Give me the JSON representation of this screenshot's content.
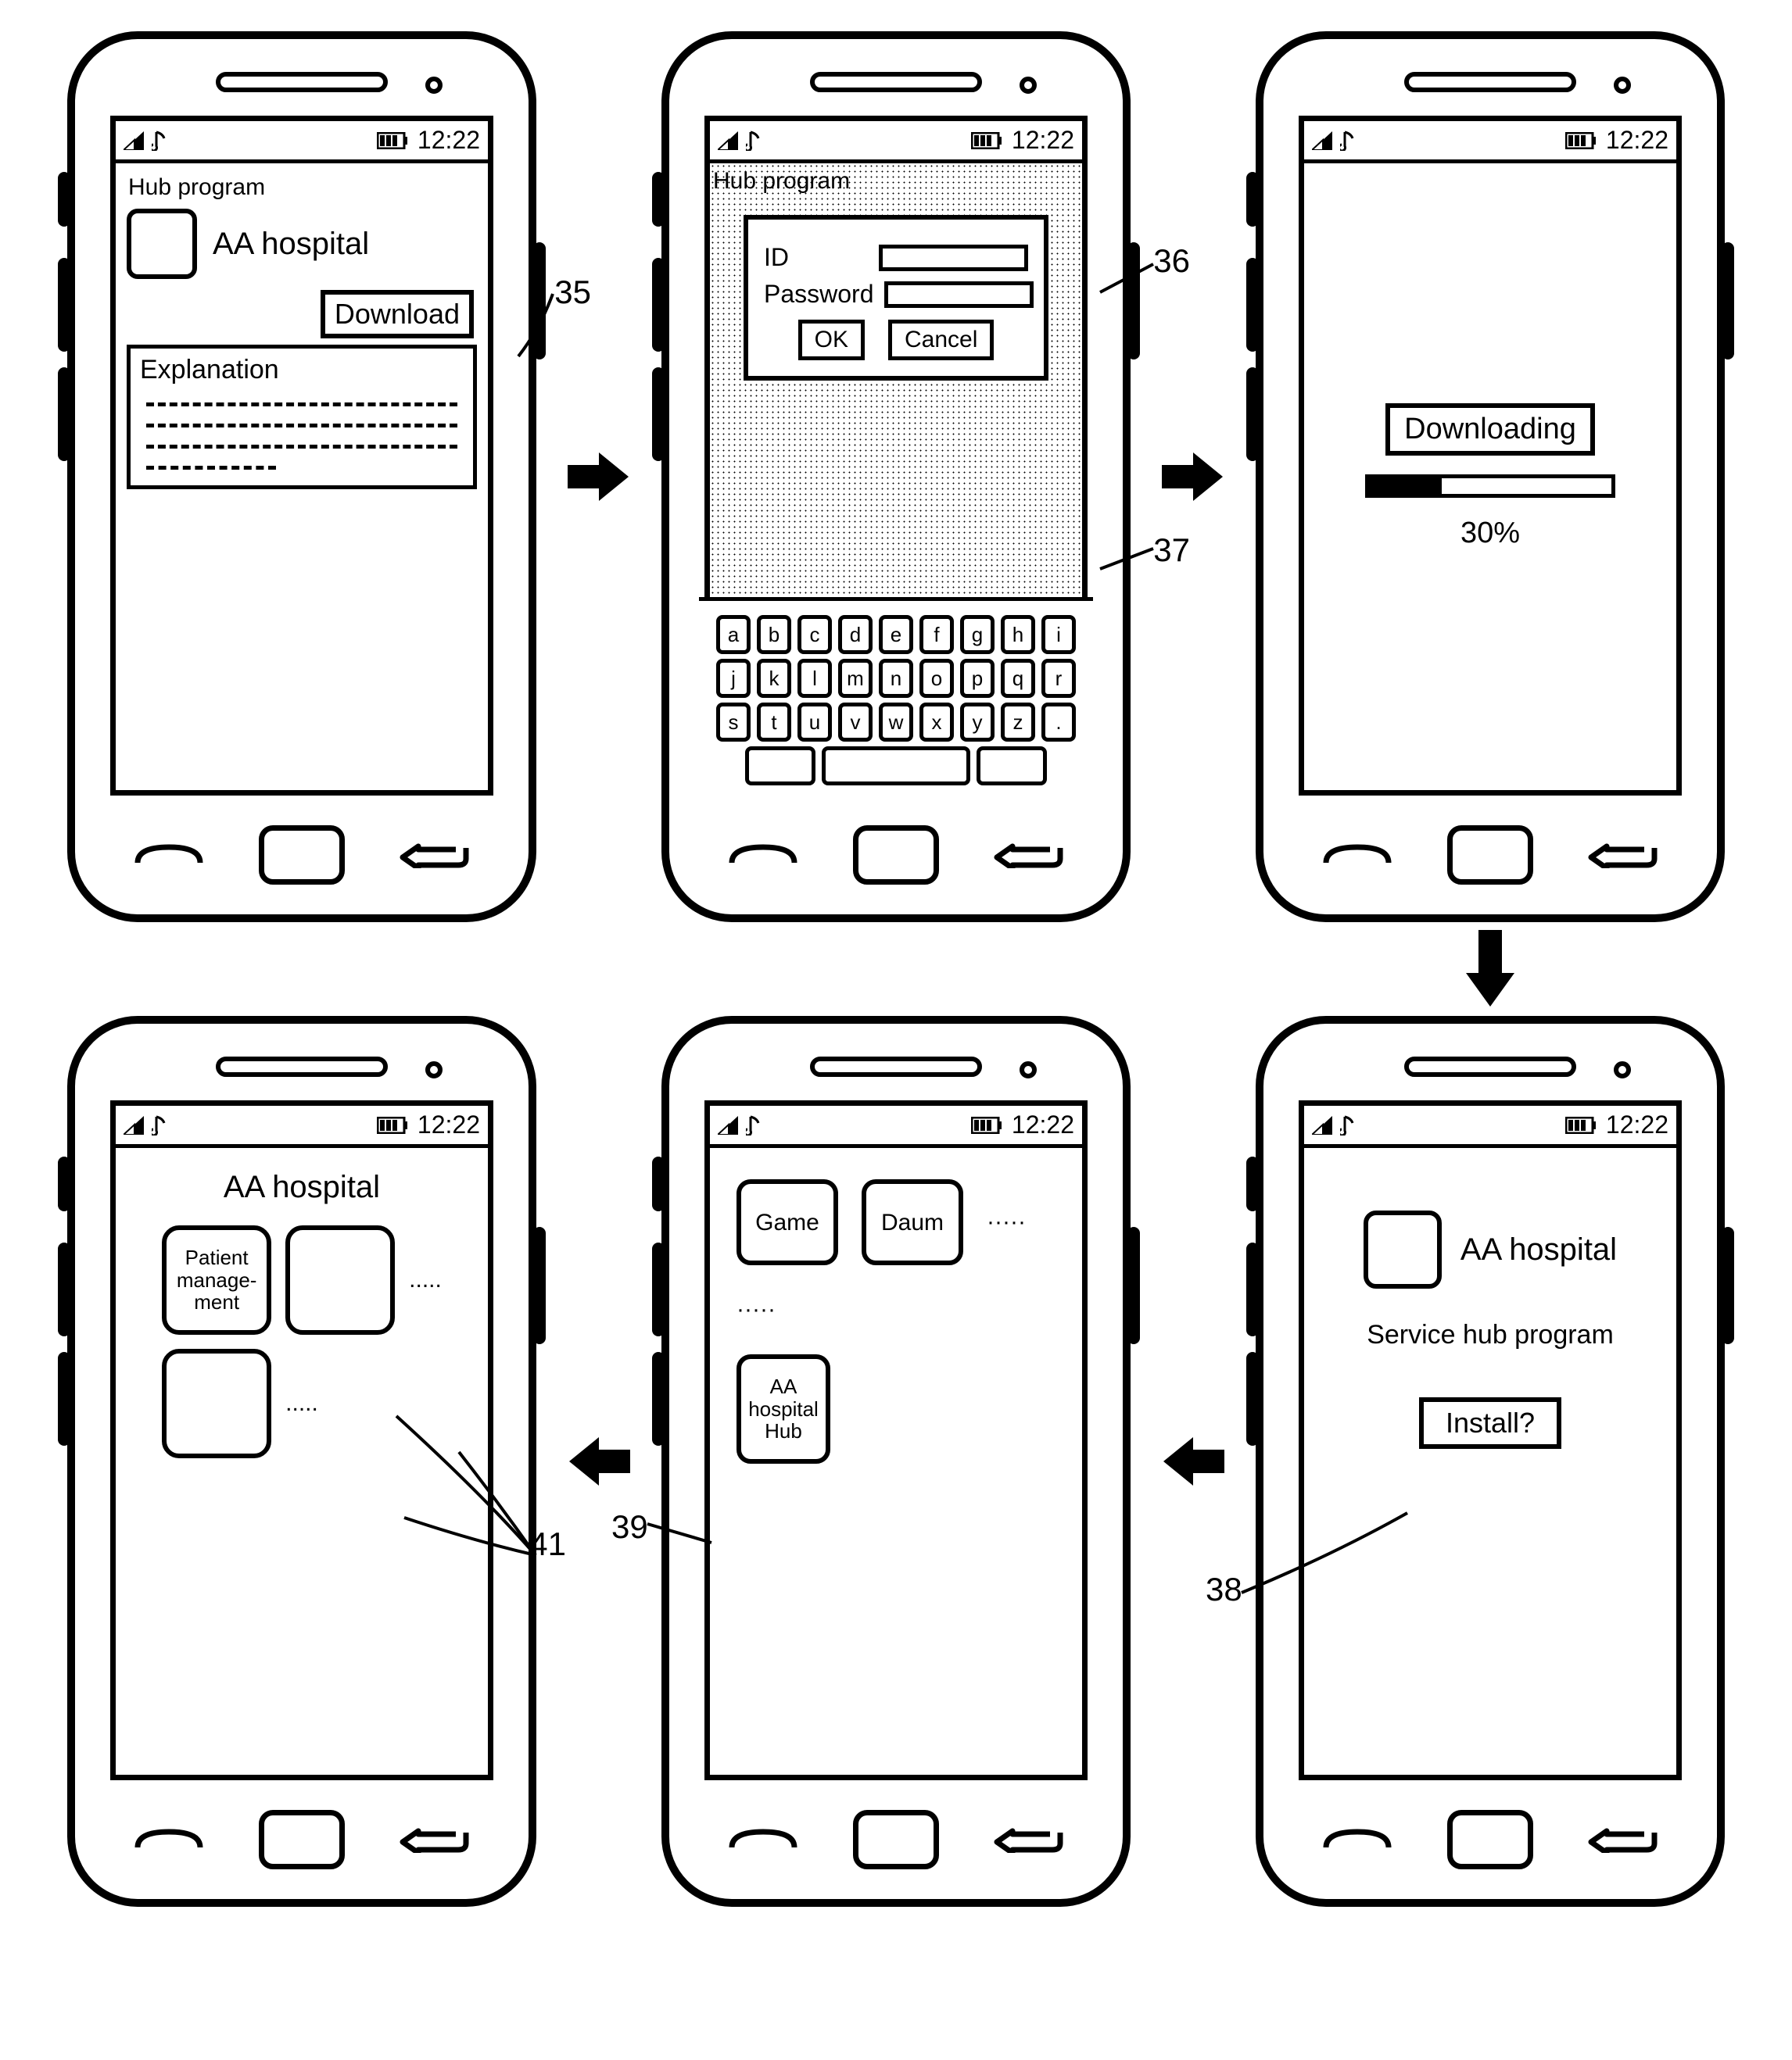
{
  "status": {
    "time": "12:22"
  },
  "refs": {
    "download": "35",
    "dialog": "36",
    "keyboard": "37",
    "install": "38",
    "hub_icon": "39",
    "sub_apps": "41"
  },
  "screen1": {
    "title": "Hub program",
    "app_name": "AA hospital",
    "download_label": "Download",
    "explanation_label": "Explanation"
  },
  "screen2": {
    "title": "Hub program",
    "id_label": "ID",
    "pw_label": "Password",
    "ok": "OK",
    "cancel": "Cancel",
    "keys_row1": [
      "a",
      "b",
      "c",
      "d",
      "e",
      "f",
      "g",
      "h",
      "i"
    ],
    "keys_row2": [
      "j",
      "k",
      "l",
      "m",
      "n",
      "o",
      "p",
      "q",
      "r"
    ],
    "keys_row3": [
      "s",
      "t",
      "u",
      "v",
      "w",
      "x",
      "y",
      "z",
      "."
    ]
  },
  "screen3": {
    "label": "Downloading",
    "percent": "30%"
  },
  "screen4": {
    "app_name": "AA hospital",
    "subtitle": "Service hub program",
    "install": "Install?"
  },
  "screen5": {
    "icons": [
      "Game",
      "Daum"
    ],
    "dots": "·····",
    "hub_icon": "AA hospital Hub"
  },
  "screen6": {
    "title": "AA hospital",
    "patient": "Patient manage- ment",
    "dots": "....."
  }
}
